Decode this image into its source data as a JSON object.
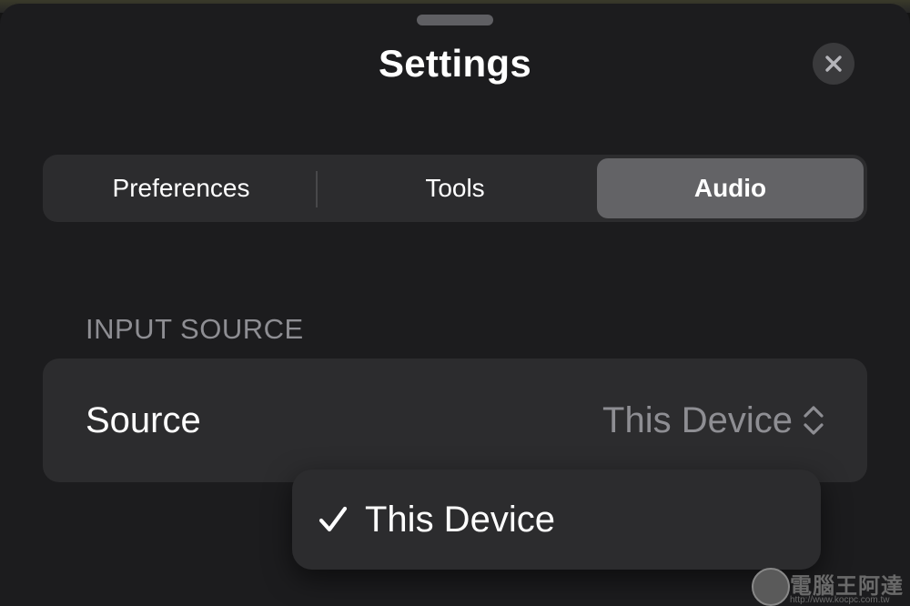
{
  "sheet": {
    "title": "Settings"
  },
  "tabs": [
    {
      "label": "Preferences",
      "selected": false
    },
    {
      "label": "Tools",
      "selected": false
    },
    {
      "label": "Audio",
      "selected": true
    }
  ],
  "input_source": {
    "header": "INPUT SOURCE",
    "row_label": "Source",
    "row_value": "This Device"
  },
  "dropdown": {
    "items": [
      {
        "label": "This Device",
        "checked": true
      }
    ]
  },
  "watermark": {
    "text": "電腦王阿達",
    "url": "http://www.kocpc.com.tw"
  },
  "icons": {
    "close": "close-icon",
    "updown": "chevron-up-down-icon",
    "check": "checkmark-icon"
  },
  "colors": {
    "background": "#1c1c1e",
    "card": "#2c2c2e",
    "selected_segment": "#636366",
    "secondary_text": "#8e8e93",
    "primary_text": "#ffffff"
  }
}
